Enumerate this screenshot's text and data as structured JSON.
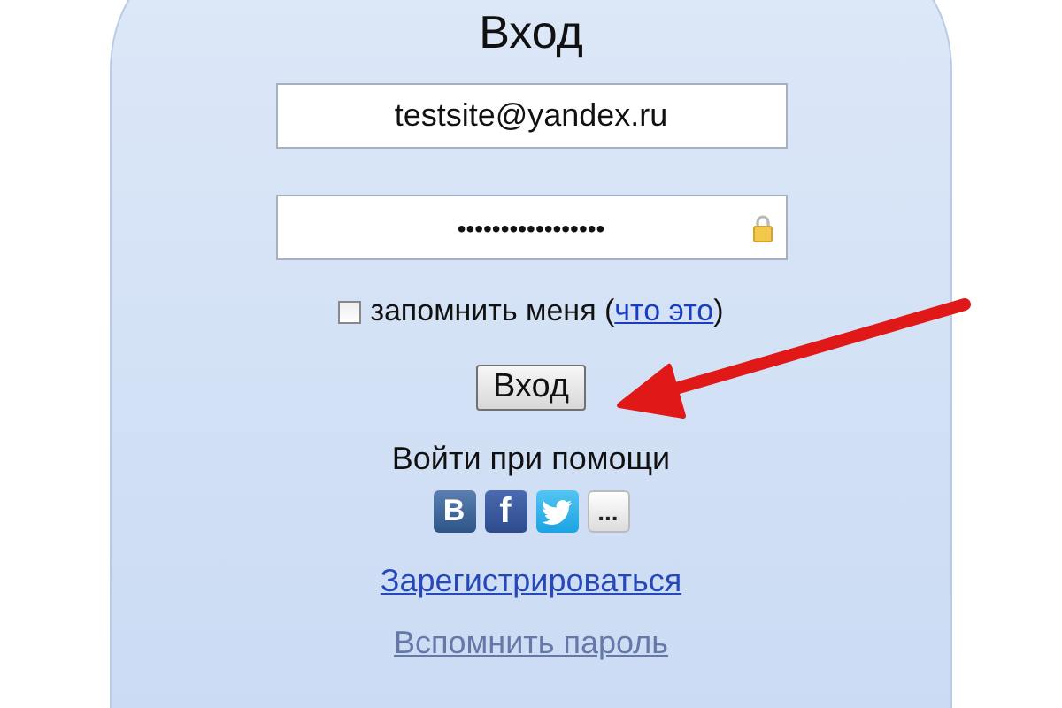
{
  "title": "Вход",
  "login": {
    "value": "testsite@yandex.ru"
  },
  "password": {
    "value": "•••••••••••••••••"
  },
  "remember": {
    "checked": false,
    "label_before": "запомнить меня (",
    "link": "что это",
    "label_after": ")"
  },
  "submit": "Вход",
  "social": {
    "heading": "Войти при помощи",
    "buttons": [
      {
        "kind": "vk",
        "label": "B"
      },
      {
        "kind": "facebook",
        "label": "f"
      },
      {
        "kind": "twitter"
      },
      {
        "kind": "more",
        "label": "..."
      }
    ]
  },
  "links": [
    {
      "label": "Зарегистрироваться",
      "kind": "primary"
    },
    {
      "label": "Вспомнить пароль",
      "kind": "muted"
    }
  ]
}
